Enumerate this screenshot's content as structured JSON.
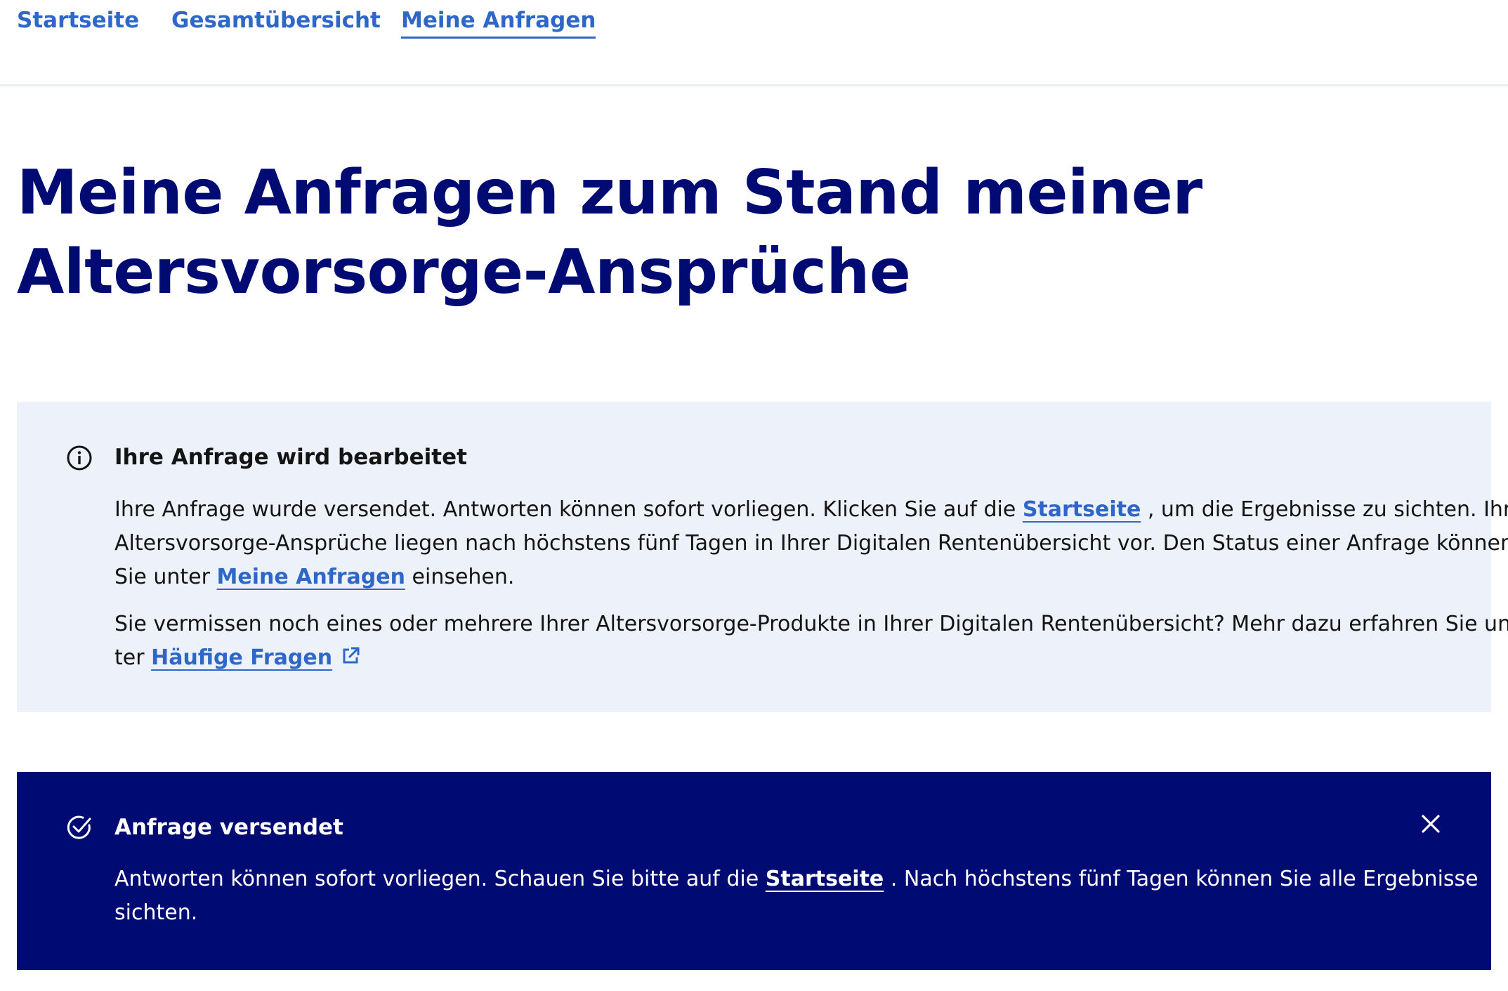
{
  "nav": {
    "items": [
      {
        "label": "Startseite"
      },
      {
        "label": "Gesamtübersicht"
      },
      {
        "label": "Meine Anfragen"
      }
    ]
  },
  "page": {
    "title_line1": "Meine Anfragen zum Stand meiner",
    "title_line2": "Altersvorsorge-Ansprüche"
  },
  "info_box": {
    "icon": "info-circle-icon",
    "title": "Ihre Anfrage wird bearbeitet",
    "p1_l1_before": "Ihre Anfrage wurde versendet. Antworten können sofort vorliegen. Klicken Sie auf die ",
    "p1_l1_link": "Startseite",
    "p1_l1_after": " , um die Ergebnisse zu sichten. Ihre",
    "p1_l2": "Altersvorsorge-Ansprüche liegen nach höchstens fünf Tagen in Ihrer Digitalen Rentenübersicht vor. Den Status einer Anfrage können",
    "p1_l3_before": "Sie unter ",
    "p1_l3_link": "Meine Anfragen",
    "p1_l3_after": " einsehen.",
    "p2_l1": "Sie vermissen noch eines oder mehrere Ihrer Altersvorsorge-Produkte in Ihrer Digitalen Rentenübersicht? Mehr dazu erfahren Sie un-",
    "p2_l2_before": "ter ",
    "p2_l2_link": "Häufige Fragen",
    "external_icon": "external-link-icon"
  },
  "success_box": {
    "icon": "check-circle-icon",
    "title": "Anfrage versendet",
    "close_icon": "close-icon",
    "l1_before": "Antworten können sofort vorliegen. Schauen Sie bitte auf die ",
    "l1_link": "Startseite",
    "l1_after": " . Nach höchstens fünf Tagen können Sie alle Ergebnisse",
    "l2": "sichten."
  },
  "colors": {
    "link": "#2f67c9",
    "heading": "#000a73",
    "info_bg": "#edf1fa",
    "success_bg": "#000a73"
  }
}
